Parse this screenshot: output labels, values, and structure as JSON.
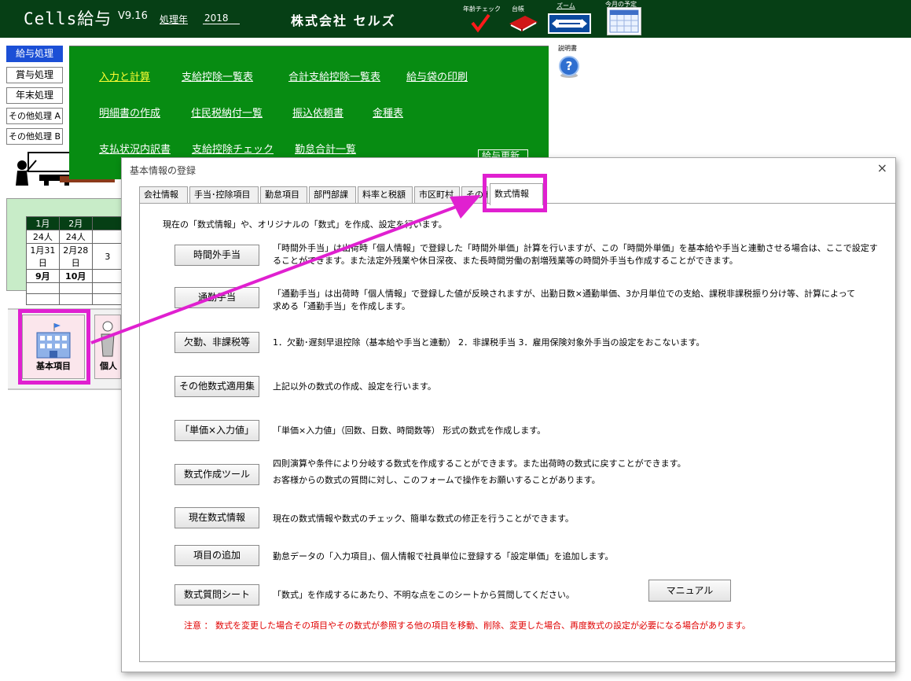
{
  "header": {
    "app_title": "Cells給与",
    "version": "V9.16",
    "year_label": "処理年",
    "year_value": "2018",
    "company": "株式会社 セルズ",
    "age_check_label": "年齢チェック",
    "ledger_label": "台帳",
    "zoom_label": "ズーム",
    "monthly_schedule_label": "今月の予定"
  },
  "sidebar": {
    "items": [
      {
        "label": "給与処理",
        "active": true
      },
      {
        "label": "賞与処理"
      },
      {
        "label": "年末処理"
      },
      {
        "label": "その他処理 A"
      },
      {
        "label": "その他処理 B"
      }
    ]
  },
  "main_menu": {
    "links": [
      {
        "label": "入力と計算",
        "active": true
      },
      {
        "label": "支給控除一覧表"
      },
      {
        "label": "合計支給控除一覧表"
      },
      {
        "label": "給与袋の印刷"
      },
      {
        "label": "明細書の作成"
      },
      {
        "label": "住民税納付一覧"
      },
      {
        "label": "振込依頼書"
      },
      {
        "label": "金種表"
      },
      {
        "label": "支払状況内訳書"
      },
      {
        "label": "支給控除チェック"
      },
      {
        "label": "勤怠合計一覧"
      }
    ],
    "update_label": "給与更新",
    "manual_label": "説明書"
  },
  "calendar": {
    "rows": [
      [
        "1月",
        "2月",
        ""
      ],
      [
        "24人",
        "24人",
        ""
      ],
      [
        "1月31日",
        "2月28日",
        "3"
      ],
      [
        "9月",
        "10月",
        ""
      ],
      [
        "",
        "",
        ""
      ],
      [
        "",
        "",
        ""
      ]
    ]
  },
  "bottom_icons": {
    "kihon_label": "基本項目",
    "kojin_label": "個人"
  },
  "dialog": {
    "title": "基本情報の登録",
    "close": "×",
    "tabs": [
      "会社情報",
      "手当･控除項目",
      "勤怠項目",
      "部門部課",
      "料率と税額",
      "市区町村",
      "その他",
      "数式情報"
    ],
    "active_tab": "数式情報",
    "intro": "現在の「数式情報」や、オリジナルの「数式」を作成、設定を行います。",
    "functions": [
      {
        "button": "時間外手当",
        "desc": [
          "「時間外手当」は出荷時「個人情報」で登録した「時間外単価」計算を行いますが、この「時間外単価」を基本給や手当と連動させる場合は、ここで設定す",
          "ることができます。また法定外残業や休日深夜、また長時間労働の割増残業等の時間外手当も作成することができます。"
        ]
      },
      {
        "button": "通勤手当",
        "desc": [
          "「通勤手当」は出荷時「個人情報」で登録した値が反映されますが、出勤日数×通勤単価、3か月単位での支給、課税非課税振り分け等、計算によって",
          "求める「通勤手当」を作成します。"
        ]
      },
      {
        "button": "欠勤、非課税等",
        "desc": [
          "1．欠勤･遅刻早退控除（基本給や手当と連動） 2．非課税手当 3．雇用保険対象外手当の設定をおこないます。"
        ]
      },
      {
        "button": "その他数式適用集",
        "desc": [
          "上記以外の数式の作成、設定を行います。"
        ]
      },
      {
        "button": "「単価×入力値」",
        "desc": [
          "「単価×入力値」（回数、日数、時間数等） 形式の数式を作成します。"
        ]
      },
      {
        "button": "数式作成ツール",
        "desc": [
          "四則演算や条件により分岐する数式を作成することができます。また出荷時の数式に戻すことができます。",
          "お客様からの数式の質問に対し、このフォームで操作をお願いすることがあります。"
        ]
      },
      {
        "button": "現在数式情報",
        "desc": [
          "現在の数式情報や数式のチェック、簡単な数式の修正を行うことができます。"
        ]
      },
      {
        "button": "項目の追加",
        "desc": [
          "勤怠データの「入力項目」、個人情報で社員単位に登録する「設定単価」を追加します。"
        ]
      },
      {
        "button": "数式質問シート",
        "desc": [
          "「数式」を作成するにあたり、不明な点をこのシートから質問してください。"
        ]
      }
    ],
    "manual_button": "マニュアル",
    "note": "注意 ： 数式を変更した場合その項目やその数式が参照する他の項目を移動、削除、変更した場合、再度数式の設定が必要になる場合があります。"
  },
  "colors": {
    "header_bg": "#063f15",
    "menu_green": "#078c12",
    "highlight_magenta": "#e020d0",
    "active_blue": "#1b4fd6",
    "note_red": "#e00000"
  }
}
